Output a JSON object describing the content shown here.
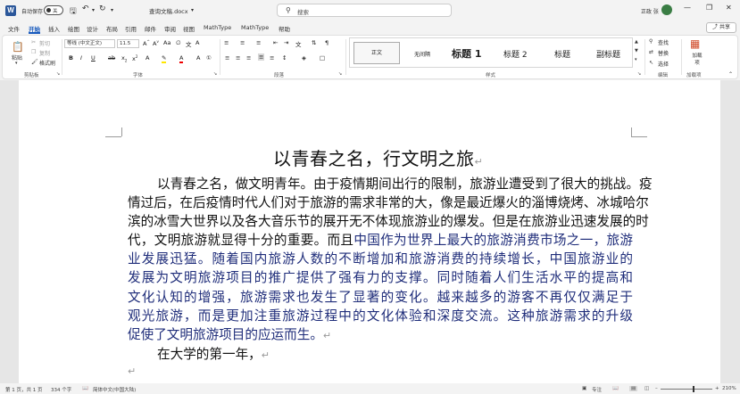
{
  "titlebar": {
    "app_icon": "W",
    "autosave_label": "自动保存",
    "autosave_state": "关",
    "doc_name": "查询文稿.docx",
    "search_placeholder": "搜索",
    "user_name": "正政 张",
    "icons": [
      "save-icon",
      "undo-icon",
      "redo-icon",
      "customize-icon",
      "search-icon",
      "minimize-icon",
      "restore-icon",
      "close-icon"
    ]
  },
  "ribbon_tabs": [
    "文件",
    "开始",
    "插入",
    "绘图",
    "设计",
    "布局",
    "引用",
    "邮件",
    "审阅",
    "视图",
    "MathType",
    "MathType",
    "帮助"
  ],
  "active_tab": "开始",
  "share_label": "共享",
  "ribbon": {
    "clipboard": {
      "paste": "粘贴",
      "cut": "剪切",
      "copy": "复制",
      "format_painter": "格式刷",
      "group": "剪贴板"
    },
    "font": {
      "name": "等线 (中文正文)",
      "size": "11.5",
      "group": "字体"
    },
    "paragraph": {
      "group": "段落"
    },
    "styles": {
      "items": [
        "正文",
        "无间隔",
        "标题 1",
        "标题 2",
        "标题",
        "副标题"
      ],
      "group": "样式"
    },
    "editing": {
      "find": "查找",
      "replace": "替换",
      "select": "选择",
      "group": "编辑"
    },
    "addins": {
      "label": "加载项",
      "group": "加载项"
    }
  },
  "document": {
    "title": "以青春之名，行文明之旅",
    "paragraph_lines": [
      "以青春之名，做文明青年。由于疫情期间出行的限制，旅游业遭受到了很大的挑战。疫",
      "情过后，在后疫情时代人们对于旅游的需求非常的大，像是最近爆火的淄博烧烤、冰城哈尔",
      "滨的冰雪大世界以及各大音乐节的展开无不体现旅游业的爆发。但是在旅游业迅速发展的时",
      "代，文明旅游就显得十分的重要。而且中国作为世界上最大的旅游消费市场之一，旅游",
      "业发展迅猛。随着国内旅游人数的不断增加和旅游消费的持续增长，中国旅游业的",
      "发展为文明旅游项目的推广提供了强有力的支撑。同时随着人们生活水平的提高和",
      "文化认知的增强，旅游需求也发生了显著的变化。越来越多的游客不再仅仅满足于",
      "观光旅游，而是更加注重旅游过程中的文化体验和深度交流。这种旅游需求的升级",
      "促使了文明旅游项目的应运而生。"
    ],
    "line4_black": "代，文明旅游就显得十分的重要。而且",
    "line4_blue": "中国作为世界上最大的旅游消费市场之一，旅游",
    "paragraph2": "在大学的第一年，",
    "paragraph_mark": "↵",
    "colors": {
      "blue_text": "#1f2d7a",
      "accent": "#185abd"
    }
  },
  "status": {
    "page": "第 1 页，共 1 页",
    "words": "334 个字",
    "language": "简体中文(中国大陆)",
    "focus": "专注",
    "zoom": "210%",
    "zoom_level_percent": 210
  }
}
